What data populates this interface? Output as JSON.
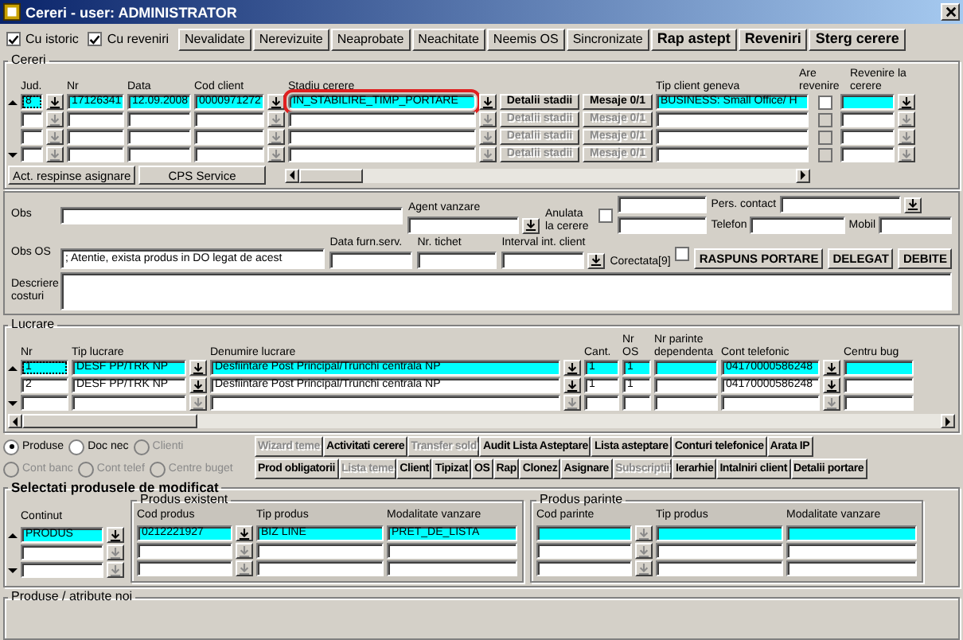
{
  "window": {
    "title": "Cereri - user: ADMINISTRATOR"
  },
  "toolbar": {
    "checkboxes": [
      {
        "label": "Cu istoric",
        "checked": true
      },
      {
        "label": "Cu reveniri",
        "checked": true
      }
    ],
    "buttons": [
      {
        "label": "Nevalidate",
        "bold": false
      },
      {
        "label": "Nerevizuite",
        "bold": false
      },
      {
        "label": "Neaprobate",
        "bold": false
      },
      {
        "label": "Neachitate",
        "bold": false
      },
      {
        "label": "Neemis OS",
        "bold": false
      },
      {
        "label": "Sincronizate",
        "bold": false
      },
      {
        "label": "Rap astept",
        "bold": true
      },
      {
        "label": "Reveniri",
        "bold": true
      },
      {
        "label": "Sterg cerere",
        "bold": true
      }
    ]
  },
  "cereri": {
    "title": "Cereri",
    "columns": [
      "Jud.",
      "Nr",
      "Data",
      "Cod client",
      "Stadiu cerere",
      "Tip client geneva",
      "Are revenire",
      "Revenire la cerere"
    ],
    "rows": [
      {
        "selected": true,
        "enabled": true,
        "jud": "8",
        "nr": "17126341",
        "data": "12.09.2008",
        "cod_client": "0000971272",
        "stadiu": "IN_STABILIRE_TIMP_PORTARE",
        "stadiu_highlighted": true,
        "detalii_button": "Detalii stadii",
        "mesaje_button": "Mesaje 0/1",
        "tip_client": "BUSINESS: Small Office/ H",
        "are_revenire": false
      },
      {
        "selected": false,
        "enabled": false,
        "stadiu_highlighted": false,
        "detalii_button": "Detalii stadii",
        "mesaje_button": "Mesaje 0/1",
        "are_revenire": false
      },
      {
        "selected": false,
        "enabled": false,
        "stadiu_highlighted": false,
        "detalii_button": "Detalii stadii",
        "mesaje_button": "Mesaje 0/1",
        "are_revenire": false
      },
      {
        "selected": false,
        "enabled": false,
        "stadiu_highlighted": false,
        "detalii_button": "Detalii stadii",
        "mesaje_button": "Mesaje 0/1",
        "are_revenire": false
      }
    ],
    "buttons": [
      "Act. respinse asignare",
      "CPS Service"
    ]
  },
  "details": {
    "obs_label": "Obs",
    "agent_label": "Agent vanzare",
    "anulata_label": "Anulata la cerere",
    "anulata_checked": false,
    "pers_contact_label": "Pers. contact",
    "telefon_label": "Telefon",
    "mobil_label": "Mobil",
    "obs_os_label": "Obs OS",
    "obs_os_value": "; Atentie, exista produs in DO legat de acest",
    "data_furn_label": "Data furn.serv.",
    "nr_tichet_label": "Nr. tichet",
    "interval_label": "Interval int. client",
    "corectata_label": "Corectata[9]",
    "corectata_checked": false,
    "buttons": [
      "RASPUNS PORTARE",
      "DELEGAT",
      "DEBITE"
    ],
    "descriere_label": "Descriere costuri"
  },
  "lucrare": {
    "title": "Lucrare",
    "columns": [
      "Nr",
      "Tip lucrare",
      "Denumire lucrare",
      "Cant.",
      "Nr OS",
      "Nr parinte dependenta",
      "Cont telefonic",
      "Centru bug"
    ],
    "rows": [
      {
        "selected": true,
        "enabled": true,
        "nr": "1",
        "tip": "DESF PP/TRK NP",
        "denumire": "Desfiintare Post Principal/Trunchi centrala NP",
        "cant": "1",
        "nr_os": "1",
        "cont": "04170000586248"
      },
      {
        "selected": false,
        "enabled": true,
        "nr": "2",
        "tip": "DESF PP/TRK NP",
        "denumire": "Desfiintare Post Principal/Trunchi centrala NP",
        "cant": "1",
        "nr_os": "1",
        "cont": "04170000586248"
      },
      {
        "selected": false,
        "enabled": false
      }
    ]
  },
  "options": {
    "radio_rows": [
      [
        {
          "label": "Produse",
          "selected": true,
          "disabled": false
        },
        {
          "label": "Doc nec",
          "selected": false,
          "disabled": false
        },
        {
          "label": "Clienti",
          "selected": false,
          "disabled": true
        }
      ],
      [
        {
          "label": "Cont banc",
          "selected": false,
          "disabled": true
        },
        {
          "label": "Cont telef",
          "selected": false,
          "disabled": true
        },
        {
          "label": "Centre buget",
          "selected": false,
          "disabled": true
        }
      ]
    ],
    "button_rows": [
      [
        {
          "label": "Wizard teme",
          "disabled": true
        },
        {
          "label": "Activitati cerere",
          "disabled": false
        },
        {
          "label": "Transfer sold",
          "disabled": true
        },
        {
          "label": "Audit Lista Asteptare",
          "disabled": false
        },
        {
          "label": "Lista asteptare",
          "disabled": false
        },
        {
          "label": "Conturi telefonice",
          "disabled": false
        },
        {
          "label": "Arata IP",
          "disabled": false
        }
      ],
      [
        {
          "label": "Prod obligatorii",
          "disabled": false
        },
        {
          "label": "Lista teme",
          "disabled": true
        },
        {
          "label": "Client",
          "disabled": false
        },
        {
          "label": "Tipizat",
          "disabled": false
        },
        {
          "label": "OS",
          "disabled": false
        },
        {
          "label": "Rap",
          "disabled": false
        },
        {
          "label": "Clonez",
          "disabled": false
        },
        {
          "label": "Asignare",
          "disabled": false
        },
        {
          "label": "Subscriptii",
          "disabled": true
        },
        {
          "label": "Ierarhie",
          "disabled": false
        },
        {
          "label": "Intalniri client",
          "disabled": false
        },
        {
          "label": "Detalii portare",
          "disabled": false
        }
      ]
    ]
  },
  "produse": {
    "title": "Selectati produsele de modificat",
    "continut_label": "Continut",
    "existent": {
      "title": "Produs existent",
      "columns": [
        "Cod produs",
        "Tip produs",
        "Modalitate vanzare"
      ]
    },
    "parinte": {
      "title": "Produs parinte",
      "columns": [
        "Cod parinte",
        "Tip produs",
        "Modalitate vanzare"
      ]
    },
    "rows": [
      {
        "selected": true,
        "enabled": true,
        "continut": "PRODUS",
        "cod_produs": "0212221927",
        "tip_produs": "BIZ LINE",
        "modalitate": "PRET_DE_LISTA"
      },
      {
        "selected": false,
        "enabled": false
      },
      {
        "selected": false,
        "enabled": false
      }
    ]
  },
  "atribute": {
    "title": "Produse / atribute noi"
  }
}
